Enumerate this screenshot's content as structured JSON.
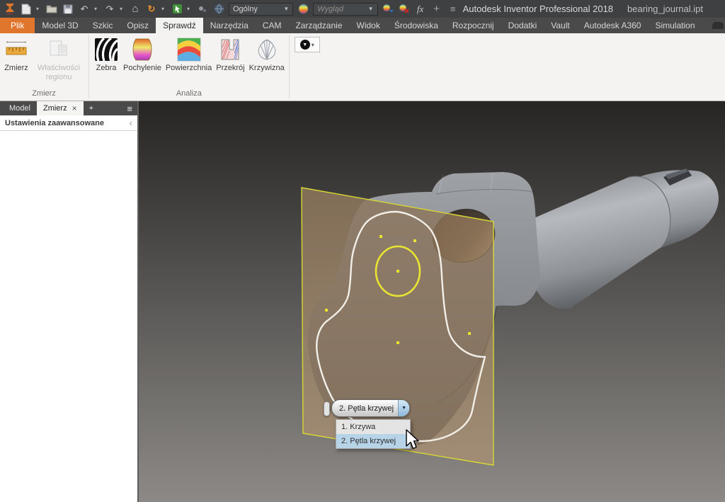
{
  "app": {
    "title": "Autodesk Inventor Professional 2018",
    "document": "bearing_journal.ipt"
  },
  "qat": {
    "material_value": "Ogólny",
    "appearance_placeholder": "Wygląd"
  },
  "icons": {
    "undo": "↶",
    "redo": "↷",
    "home": "⌂",
    "update": "↻",
    "dropdown": "▼",
    "small_arrow": "▾",
    "fx": "fx",
    "plus": "+",
    "menu": "≡",
    "close": "×",
    "chevron_left": "‹"
  },
  "ribbon": {
    "active_tab": "Sprawdź",
    "tabs": [
      {
        "label": "Plik"
      },
      {
        "label": "Model 3D"
      },
      {
        "label": "Szkic"
      },
      {
        "label": "Opisz"
      },
      {
        "label": "Sprawdź"
      },
      {
        "label": "Narzędzia"
      },
      {
        "label": "CAM"
      },
      {
        "label": "Zarządzanie"
      },
      {
        "label": "Widok"
      },
      {
        "label": "Środowiska"
      },
      {
        "label": "Rozpocznij"
      },
      {
        "label": "Dodatki"
      },
      {
        "label": "Vault"
      },
      {
        "label": "Autodesk A360"
      },
      {
        "label": "Simulation"
      }
    ],
    "groups": [
      {
        "label": "Zmierz",
        "tools": [
          {
            "label": "Zmierz",
            "icon": "measure-icon"
          },
          {
            "label": "Właściwości regionu",
            "icon": "region-properties-icon",
            "disabled": true
          }
        ]
      },
      {
        "label": "Analiza",
        "tools": [
          {
            "label": "Zebra",
            "icon": "zebra-icon"
          },
          {
            "label": "Pochylenie",
            "icon": "draft-icon"
          },
          {
            "label": "Powierzchnia",
            "icon": "surface-icon"
          },
          {
            "label": "Przekrój",
            "icon": "section-icon"
          },
          {
            "label": "Krzywizna",
            "icon": "curvature-icon"
          }
        ]
      }
    ]
  },
  "left_panel": {
    "tabs": [
      {
        "label": "Model"
      },
      {
        "label": "Zmierz",
        "active": true
      }
    ],
    "header": "Ustawienia zaawansowane"
  },
  "viewport": {
    "selector": {
      "value": "2. Pętla krzywej",
      "options": [
        {
          "label": "1. Krzywa"
        },
        {
          "label": "2. Pętla krzywej",
          "highlighted": true
        }
      ]
    }
  },
  "colors": {
    "accent_orange": "#e0762c",
    "selection_yellow": "#e9e431",
    "plane_border_yellow": "#d8d832",
    "plane_fill": "rgba(186,152,112,0.55)",
    "curve_white": "#f2efe8",
    "list_highlight": "#b7d3e8"
  }
}
